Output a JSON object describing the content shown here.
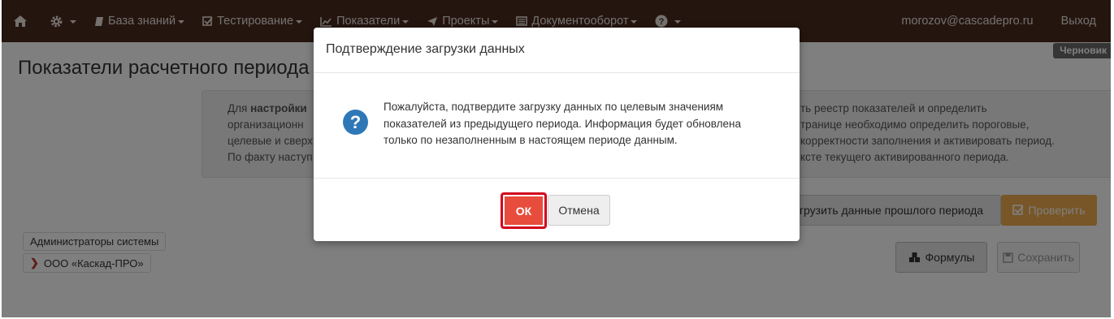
{
  "navbar": {
    "home_icon": "home-icon",
    "settings_icon": "gear-icon",
    "items": [
      {
        "label": "База знаний",
        "icon": "book-icon"
      },
      {
        "label": "Тестирование",
        "icon": "checkbox-icon"
      },
      {
        "label": "Показатели",
        "icon": "line-chart-icon"
      },
      {
        "label": "Проекты",
        "icon": "paper-plane-icon"
      },
      {
        "label": "Документооборот",
        "icon": "document-icon"
      }
    ],
    "help_icon": "question-circle-icon",
    "user_email": "morozov@cascadepro.ru",
    "logout_label": "Выход"
  },
  "page": {
    "title": "Показатели расчетного периода",
    "badge": "Черновик",
    "info_lines_left": [
      "Для настройки",
      "организационн",
      "целевые и сверх",
      "По факту наступ"
    ],
    "info_lines_right": [
      "ть реестр показателей и определить",
      "транице необходимо определить пороговые,",
      "корректности заполнения и активировать период.",
      "ксте текущего активированного периода."
    ],
    "load_prev_button": "грузить данные прошлого периода",
    "check_button": "Проверить",
    "formulas_button": "Формулы",
    "save_button": "Сохранить",
    "tree": {
      "item1": "Администраторы системы",
      "item2": "ООО «Каскад-ПРО»"
    }
  },
  "modal": {
    "title": "Подтверждение загрузки данных",
    "icon": "question-circle-icon",
    "message_lines": [
      "Пожалуйста, подтвердите загрузку данных по целевым значениям",
      "показателей из предыдущего периода. Информация будет обновлена",
      "только по незаполненным в настоящем периоде данным."
    ],
    "ok_label": "ОК",
    "cancel_label": "Отмена"
  },
  "colors": {
    "navbar_bg": "#4a2a1f",
    "ok_button": "#e74c3c",
    "check_button": "#f0ad4e",
    "question_icon": "#2f78b7",
    "highlight_border": "#d0021b"
  }
}
